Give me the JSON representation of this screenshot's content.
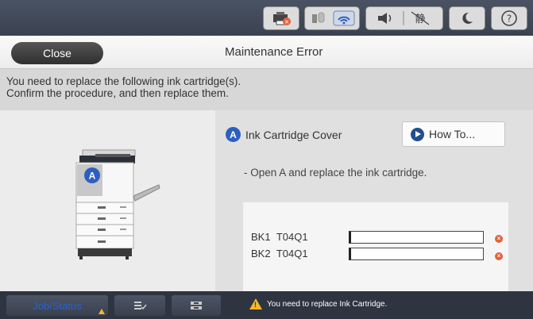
{
  "status_bar": {
    "icons": [
      "printer-ink-warning-icon",
      "wired-network-icon",
      "wifi-icon",
      "volume-icon",
      "quiet-mode-icon",
      "sleep-icon",
      "help-icon"
    ]
  },
  "header": {
    "close_label": "Close",
    "title": "Maintenance Error"
  },
  "message": {
    "line1": "You need to replace the following ink cartridge(s).",
    "line2": "Confirm the procedure, and then replace them."
  },
  "cover": {
    "badge": "A",
    "label": "Ink Cartridge Cover"
  },
  "how_to_label": "How To...",
  "instruction": "- Open A and replace the ink cartridge.",
  "cartridges": [
    {
      "color": "BK1",
      "model": "T04Q1",
      "level": 0.0
    },
    {
      "color": "BK2",
      "model": "T04Q1",
      "level": 0.0
    }
  ],
  "bottom_bar": {
    "job_status_label": "Job/Status",
    "status_text": "You need to replace Ink Cartridge."
  },
  "colors": {
    "accent": "#2c5fbf",
    "error": "#e4603a",
    "warning": "#f2b72b"
  }
}
